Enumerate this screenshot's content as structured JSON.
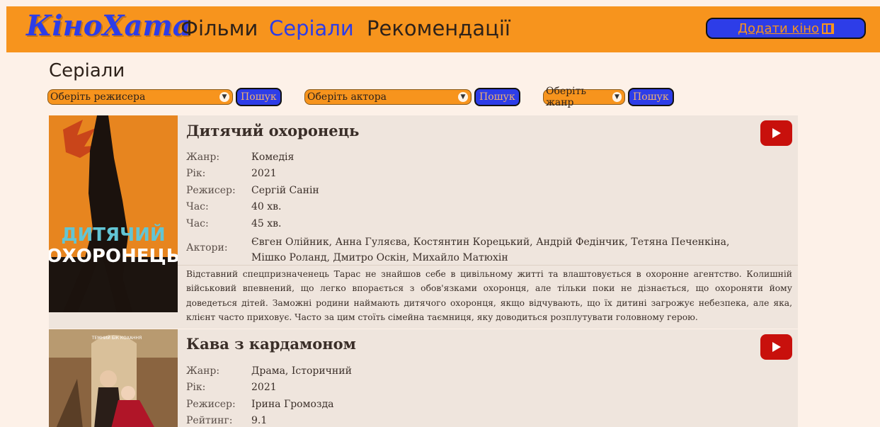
{
  "header": {
    "logo": "КіноХата",
    "nav": [
      "Фільми",
      "Серіали",
      "Рекомендації"
    ],
    "add_button": "Додати кіно",
    "colors": {
      "bar": "#f7941d",
      "accent": "#2d3de8"
    }
  },
  "page_title": "Серіали",
  "filters": [
    {
      "placeholder": "Оберіть режисера",
      "button": "Пошук"
    },
    {
      "placeholder": "Оберіть актора",
      "button": "Пошук"
    },
    {
      "placeholder": "Оберіть жанр",
      "button": "Пошук"
    }
  ],
  "series": [
    {
      "title": "Дитячий охоронець",
      "poster_text": [
        "ДИТЯЧИЙ",
        "ОХОРОНЕЦЬ"
      ],
      "fields": [
        {
          "label": "Жанр:",
          "value": "Комедія"
        },
        {
          "label": "Рік:",
          "value": "2021"
        },
        {
          "label": "Режисер:",
          "value": "Сергій Санін"
        },
        {
          "label": "Час:",
          "value": "40 хв."
        },
        {
          "label": "Час:",
          "value": "45 хв."
        }
      ],
      "actors_label": "Актори:",
      "actors": "Євген Олійник, Анна Гуляєва, Костянтин Корецький, Андрій Федінчик, Тетяна Печенкіна, Мішко Роланд, Дмитро Оскін, Михайло Матюхін",
      "description": "Відставний спецпризначенець Тарас не знайшов себе в цивільному житті та влаштовується в охоронне агентство. Колишній військовий впевнений, що легко впорається з обов'язками охоронця, але тільки поки не дізнається, що охороняти йому доведеться дітей. Заможні родини наймають дитячого охоронця, якщо відчувають, що їх дитині загрожує небезпека, але яка, клієнт часто приховує. Часто за цим стоїть сімейна таємниця, яку доводиться розплутувати головному герою."
    },
    {
      "title": "Кава з кардамоном",
      "poster_text": [
        "ТЕМНИЙ БІК КОХАННЯ"
      ],
      "fields": [
        {
          "label": "Жанр:",
          "value": "Драма, Історичний"
        },
        {
          "label": "Рік:",
          "value": "2021"
        },
        {
          "label": "Режисер:",
          "value": "Ірина Громозда"
        },
        {
          "label": "Рейтинг:",
          "value": "9.1"
        }
      ]
    }
  ]
}
